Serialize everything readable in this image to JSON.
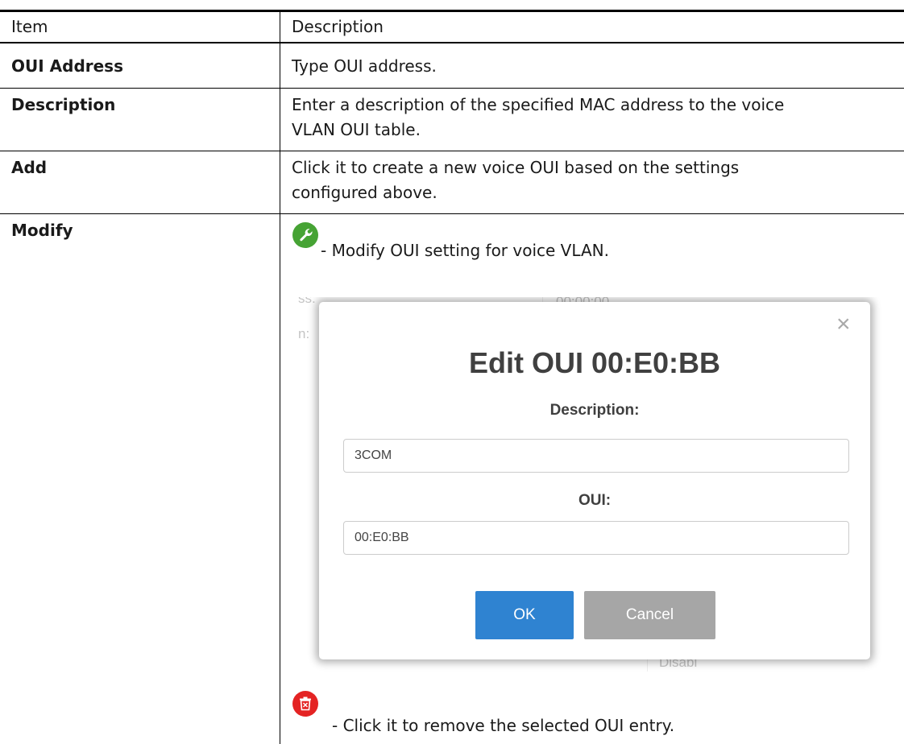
{
  "table": {
    "headers": [
      "Item",
      "Description"
    ],
    "rows": [
      {
        "item": "OUI Address",
        "description": [
          "Type OUI address."
        ]
      },
      {
        "item": "Description",
        "description": [
          "Enter a description of the specified MAC address to the voice",
          "VLAN OUI table."
        ]
      },
      {
        "item": "Add",
        "description": [
          "Click it to create a new voice OUI based on the settings",
          "configured above."
        ]
      },
      {
        "item": "Modify",
        "description_modify": "- Modify OUI setting for voice VLAN.",
        "description_delete": "- Click it to remove the selected OUI entry."
      }
    ]
  },
  "icons": {
    "modify": "wrench-icon",
    "delete": "trash-icon"
  },
  "colors": {
    "modify_icon": "#46a334",
    "delete_icon": "#e42323",
    "ok_button": "#2f83d1",
    "cancel_button": "#a6a6a6"
  },
  "modal": {
    "title": "Edit OUI 00:E0:BB",
    "description_label": "Description:",
    "description_value": "3COM",
    "oui_label": "OUI:",
    "oui_value": "00:E0:BB",
    "ok_label": "OK",
    "cancel_label": "Cancel",
    "close_glyph": "×"
  },
  "background_fragments": {
    "a": "ss:",
    "b": "n:",
    "c": "00:00:00",
    "d": "Disabl"
  }
}
